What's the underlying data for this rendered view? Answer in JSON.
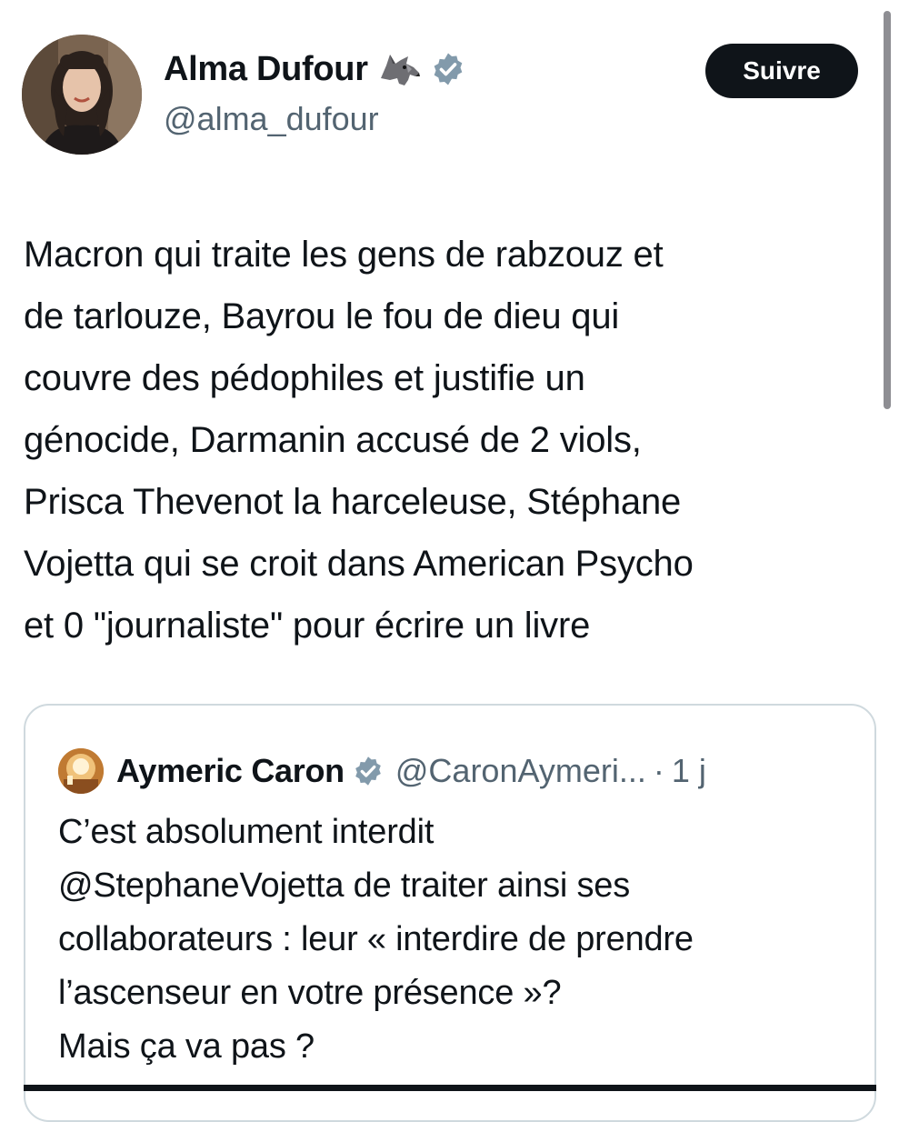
{
  "author": {
    "name": "Alma Dufour",
    "name_emoji": "wolf-emoji",
    "verified_icon": "verified-badge-icon",
    "handle": "@alma_dufour",
    "follow_label": "Suivre"
  },
  "tweet": {
    "text": "Macron qui traite les gens de rabzouz et\nde tarlouze, Bayrou le fou de dieu qui\ncouvre des pédophiles et justifie un\ngénocide, Darmanin accusé de 2 viols,\nPrisca Thevenot la harceleuse, Stéphane\nVojetta qui se croit dans American Psycho\net 0 \"journaliste\" pour écrire un livre"
  },
  "quote": {
    "name": "Aymeric Caron",
    "handle": "@CaronAymeri...",
    "separator": "·",
    "time": "1 j",
    "text": "C’est absolument interdit\n@StephaneVojetta de traiter ainsi ses\ncollaborateurs : leur « interdire de prendre\nl’ascenseur en votre présence »?\nMais ça va pas ?"
  },
  "colors": {
    "text": "#0f1419",
    "secondary": "#536471",
    "verified_badge": "#829aab",
    "button_bg": "#0f1419",
    "border": "#cfd9de"
  }
}
